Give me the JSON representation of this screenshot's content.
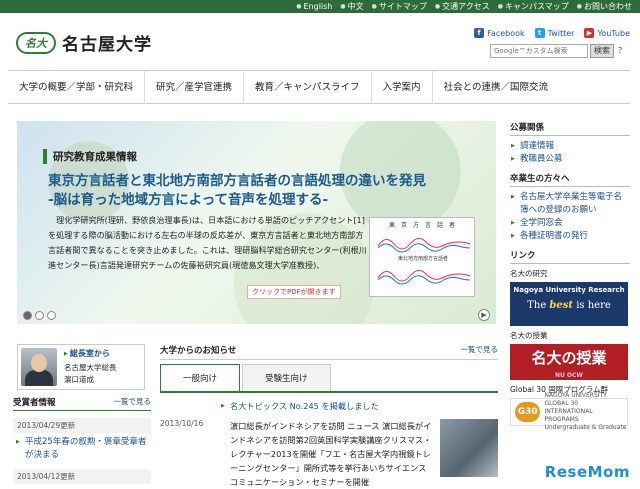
{
  "topbar": {
    "links": [
      "English",
      "中文",
      "サイトマップ",
      "交通アクセス",
      "キャンパスマップ",
      "お問い合わせ"
    ]
  },
  "header": {
    "logo_mark": "名大",
    "site_name": "名古屋大学",
    "social": [
      {
        "label": "Facebook",
        "icon": "facebook-icon",
        "color": "#3b5998",
        "glyph": "f"
      },
      {
        "label": "Twitter",
        "icon": "twitter-icon",
        "color": "#1da1f2",
        "glyph": "t"
      },
      {
        "label": "YouTube",
        "icon": "youtube-icon",
        "color": "#d32f2f",
        "glyph": "▶"
      }
    ],
    "search_placeholder": "Google™カスタム検索",
    "search_button": "検索",
    "help_label": "？"
  },
  "nav": {
    "items": [
      "大学の概要／学部・研究科",
      "研究／産学官連携",
      "教育／キャンパスライフ",
      "入学案内",
      "社会との連携／国際交流"
    ]
  },
  "hero": {
    "category": "研究教育成果情報",
    "headline1": "東京方言話者と東北地方南部方言話者の言語処理の違いを発見",
    "headline2": "-脳は育った地域方言によって音声を処理する-",
    "body": "　理化学研究所(理研、野依良治理事長)は、日本語における単語のピッチアクセント[1]を処理する際の脳活動における左右の半球の反応差が、東京方言話者と東北地方南部方言話者間で異なることを突き止めました。これは、理研脳科学総合研究センター(利根川進センター長)言語発達研究チームの佐藤裕研究員(現徳島文理大学准教授)、",
    "figure_title": "東　京　方　言　話　者",
    "figure_title2": "東北地方南部方言話者",
    "pdf_label": "クリックでPDFが開きます",
    "next_label": "▶",
    "slides": 3,
    "active_slide": 0
  },
  "sidebar": {
    "sections": [
      {
        "title": "公募関係",
        "links": [
          "調達情報",
          "教職員公募"
        ]
      },
      {
        "title": "卒業生の方々へ",
        "links": [
          "名古屋大学卒業生等電子名簿への登録のお願い",
          "全学同窓会",
          "各種証明書の発行"
        ]
      },
      {
        "title": "リンク",
        "links": []
      }
    ],
    "research_label": "名大の研究",
    "research_banner_title": "Nagoya University Research",
    "research_banner_pre": "The ",
    "research_banner_em": "best",
    "research_banner_post": " is here",
    "classes_label": "名大の授業",
    "classes_banner": "名大の授業",
    "classes_banner_sub": "NU OCW",
    "g30_label": "Global 30 国際プログラム群",
    "g30_mark": "G30",
    "g30_text1": "NAGOYA UNIVERSITY",
    "g30_text2": "GLOBAL 30",
    "g30_text3": "INTERNATIONAL PROGRAMS",
    "g30_text4": "Undergraduate & Graduate"
  },
  "president": {
    "link": "総長室から",
    "title": "名古屋大学総長",
    "name": "濵口道成"
  },
  "awards": {
    "title": "受賞者情報",
    "more": "一覧で見る",
    "items": [
      {
        "date": "2013/04/29更新",
        "text": "平成25年春の叙勲・褒章受章者が決まる"
      },
      {
        "date": "2013/04/12更新",
        "text": ""
      }
    ]
  },
  "news": {
    "title": "大学からのお知らせ",
    "more": "一覧で見る",
    "tabs": [
      "一般向け",
      "受験生向け"
    ],
    "items": [
      {
        "date": "",
        "text": "名大トピックス No.245 を掲載しました"
      },
      {
        "date": "2013/10/16",
        "text": "濵口総長がインドネシアを訪問 ニュース 濵口総長がインドネシアを訪問第2回英国科学実験講座クリスマス・レクチャー2013を開催「フエ・名古屋大学内視鏡トレーニングセンター」開所式等を挙行あいちサイエンスコミュニケーション・セミナーを開催"
      }
    ]
  },
  "watermark": {
    "pre": "Rese",
    "post": "Mom"
  }
}
